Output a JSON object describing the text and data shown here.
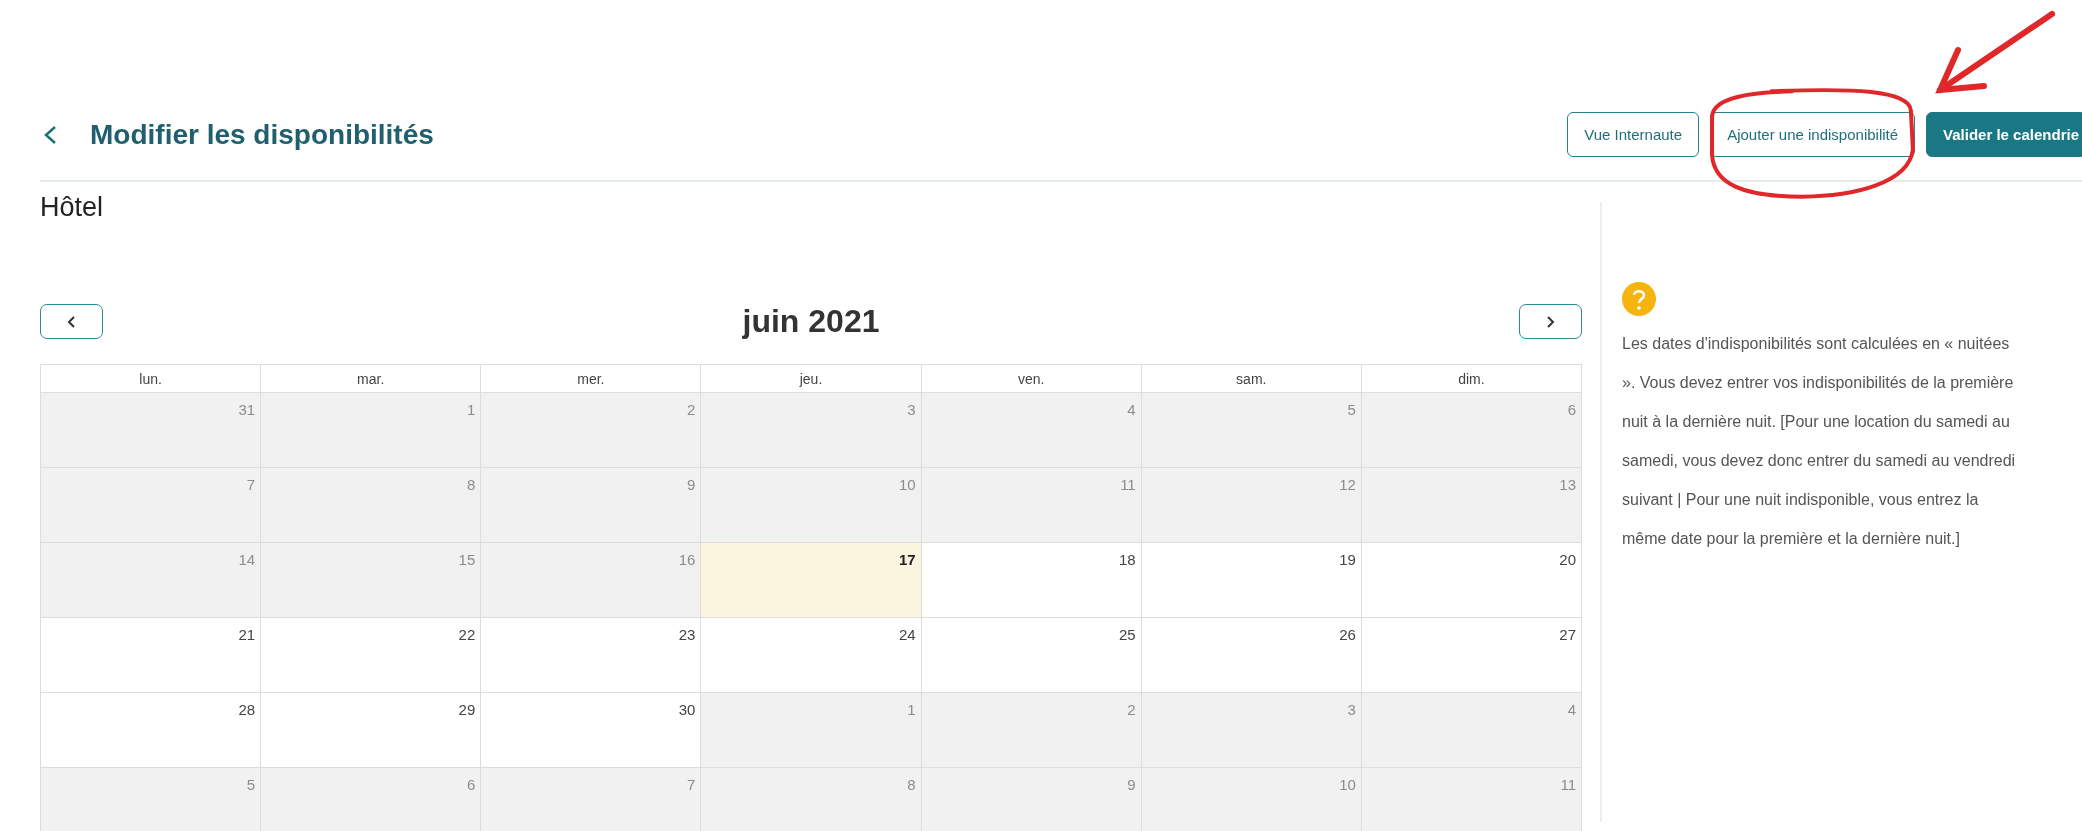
{
  "header": {
    "title": "Modifier les disponibilités",
    "buttons": [
      {
        "label": "Vue Internaute",
        "kind": "outline",
        "circled": false
      },
      {
        "label": "Ajouter une indisponibilité",
        "kind": "outline",
        "circled": true
      },
      {
        "label": "Valider le calendrie",
        "kind": "primary",
        "circled": false
      }
    ]
  },
  "pointer_arrow": true,
  "section_title": "Hôtel",
  "calendar": {
    "month": "juin 2021",
    "weekdays": [
      "lun.",
      "mar.",
      "mer.",
      "jeu.",
      "ven.",
      "sam.",
      "dim."
    ],
    "weeks": [
      [
        {
          "day": "31",
          "disabled": true,
          "today": false
        },
        {
          "day": "1",
          "disabled": true,
          "today": false
        },
        {
          "day": "2",
          "disabled": true,
          "today": false
        },
        {
          "day": "3",
          "disabled": true,
          "today": false
        },
        {
          "day": "4",
          "disabled": true,
          "today": false
        },
        {
          "day": "5",
          "disabled": true,
          "today": false
        },
        {
          "day": "6",
          "disabled": true,
          "today": false
        }
      ],
      [
        {
          "day": "7",
          "disabled": true,
          "today": false
        },
        {
          "day": "8",
          "disabled": true,
          "today": false
        },
        {
          "day": "9",
          "disabled": true,
          "today": false
        },
        {
          "day": "10",
          "disabled": true,
          "today": false
        },
        {
          "day": "11",
          "disabled": true,
          "today": false
        },
        {
          "day": "12",
          "disabled": true,
          "today": false
        },
        {
          "day": "13",
          "disabled": true,
          "today": false
        }
      ],
      [
        {
          "day": "14",
          "disabled": true,
          "today": false
        },
        {
          "day": "15",
          "disabled": true,
          "today": false
        },
        {
          "day": "16",
          "disabled": true,
          "today": false
        },
        {
          "day": "17",
          "disabled": false,
          "today": true
        },
        {
          "day": "18",
          "disabled": false,
          "today": false
        },
        {
          "day": "19",
          "disabled": false,
          "today": false
        },
        {
          "day": "20",
          "disabled": false,
          "today": false
        }
      ],
      [
        {
          "day": "21",
          "disabled": false,
          "today": false
        },
        {
          "day": "22",
          "disabled": false,
          "today": false
        },
        {
          "day": "23",
          "disabled": false,
          "today": false
        },
        {
          "day": "24",
          "disabled": false,
          "today": false
        },
        {
          "day": "25",
          "disabled": false,
          "today": false
        },
        {
          "day": "26",
          "disabled": false,
          "today": false
        },
        {
          "day": "27",
          "disabled": false,
          "today": false
        }
      ],
      [
        {
          "day": "28",
          "disabled": false,
          "today": false
        },
        {
          "day": "29",
          "disabled": false,
          "today": false
        },
        {
          "day": "30",
          "disabled": false,
          "today": false
        },
        {
          "day": "1",
          "disabled": true,
          "today": false
        },
        {
          "day": "2",
          "disabled": true,
          "today": false
        },
        {
          "day": "3",
          "disabled": true,
          "today": false
        },
        {
          "day": "4",
          "disabled": true,
          "today": false
        }
      ],
      [
        {
          "day": "5",
          "disabled": true,
          "today": false
        },
        {
          "day": "6",
          "disabled": true,
          "today": false
        },
        {
          "day": "7",
          "disabled": true,
          "today": false
        },
        {
          "day": "8",
          "disabled": true,
          "today": false
        },
        {
          "day": "9",
          "disabled": true,
          "today": false
        },
        {
          "day": "10",
          "disabled": true,
          "today": false
        },
        {
          "day": "11",
          "disabled": true,
          "today": false
        }
      ]
    ]
  },
  "help": {
    "text": "Les dates d'indisponibilités sont calculées en « nuitées ». Vous devez entrer vos indisponibilités de la première nuit à la dernière nuit. [Pour une location du samedi au samedi, vous devez donc entrer du samedi au vendredi suivant | Pour une nuit indisponible, vous entrez la même date pour la première et la dernière nuit.]"
  }
}
